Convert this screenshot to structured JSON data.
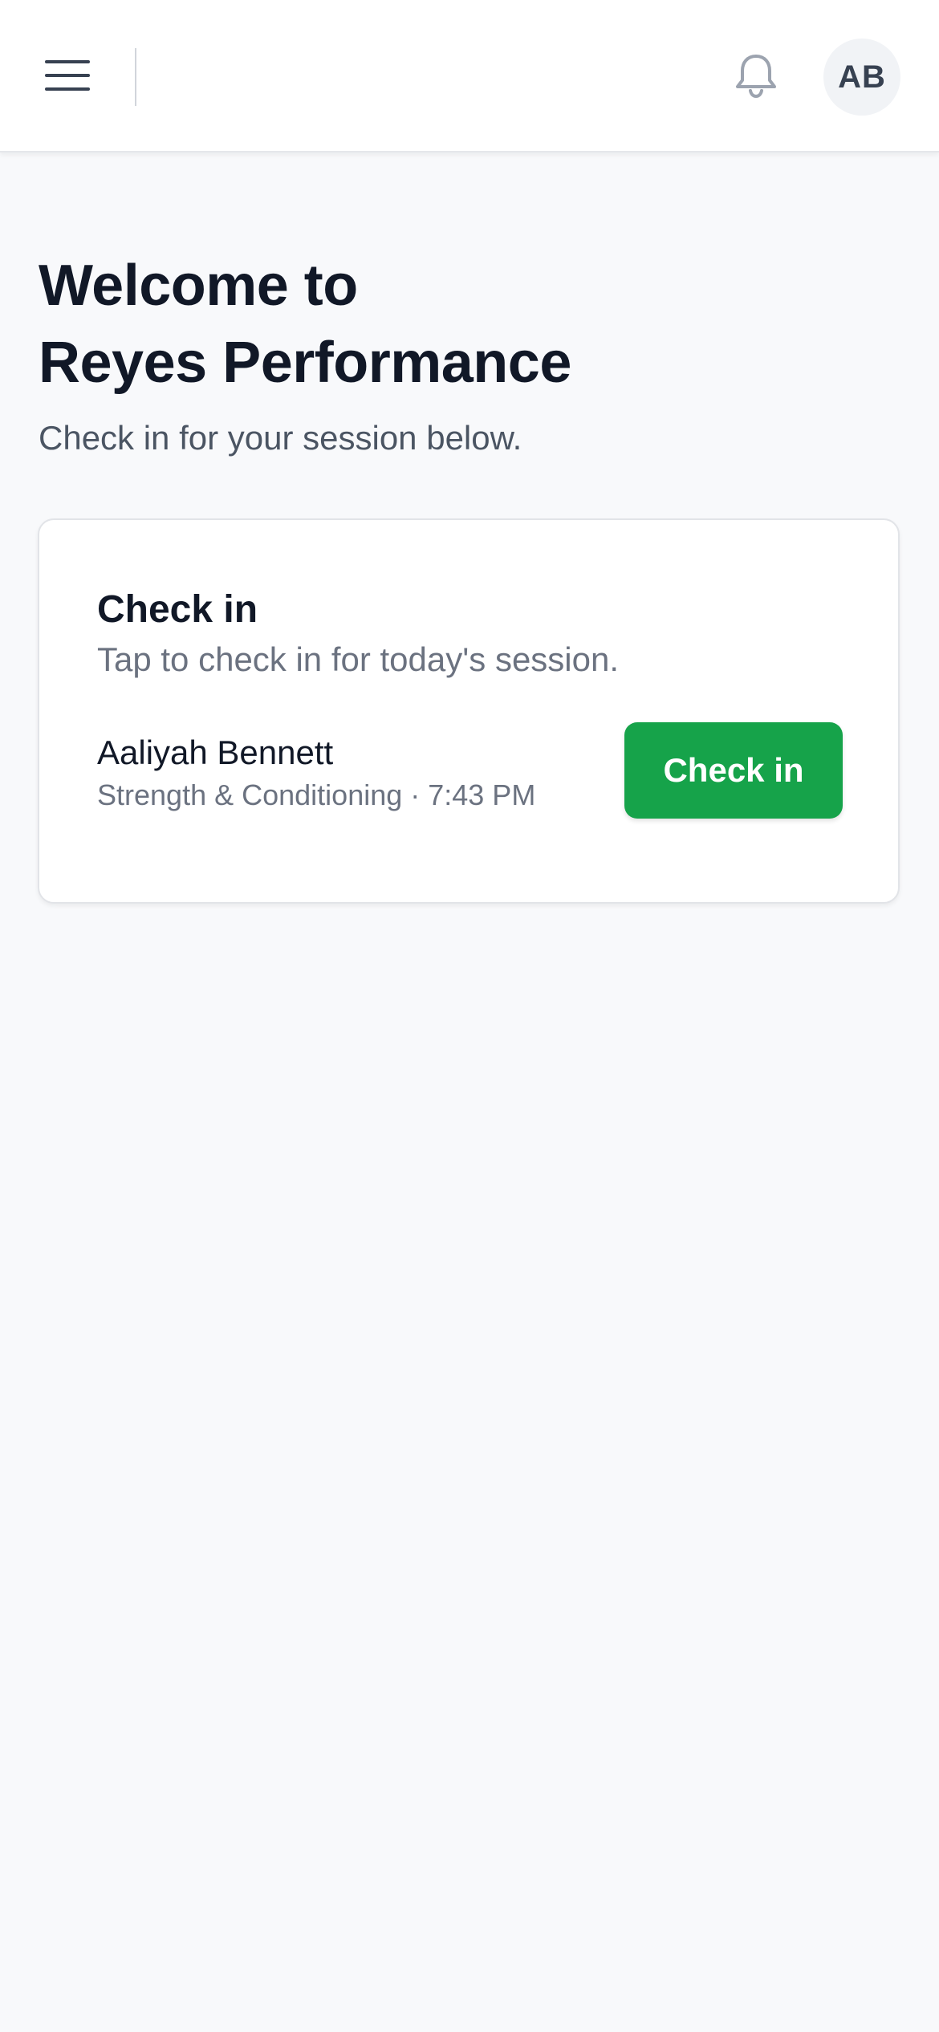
{
  "header": {
    "menu_icon": "menu-icon",
    "notification_icon": "bell-icon",
    "avatar_initials": "AB"
  },
  "welcome": {
    "title_line1": "Welcome to",
    "title_line2": "Reyes Performance",
    "subtitle": "Check in for your session below."
  },
  "checkin_card": {
    "title": "Check in",
    "subtitle": "Tap to check in for today's session.",
    "member_name": "Aaliyah Bennett",
    "session_info": "Strength & Conditioning · 7:43 PM",
    "button_label": "Check in"
  },
  "colors": {
    "accent_green": "#16a34a",
    "background": "#f8f9fb",
    "text_primary": "#111827",
    "text_secondary": "#6b7280"
  }
}
